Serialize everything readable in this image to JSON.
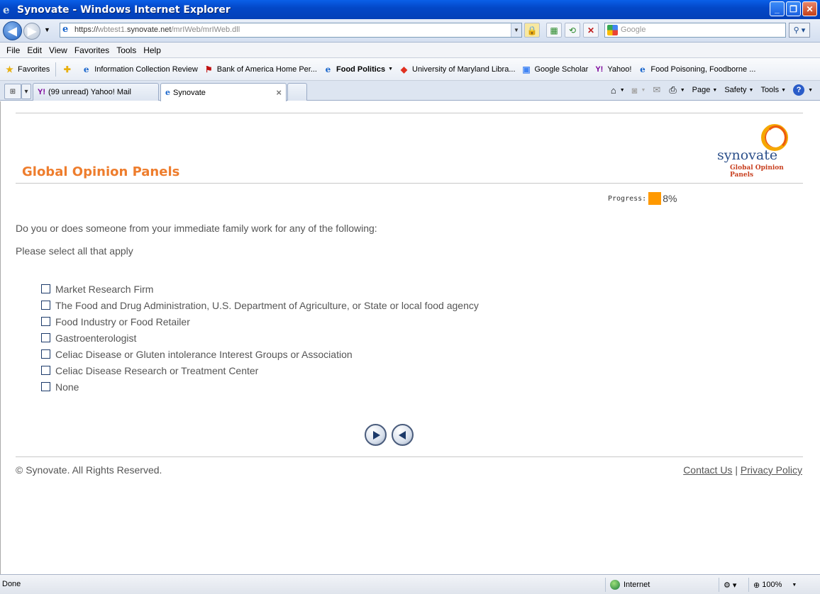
{
  "window": {
    "title": "Synovate - Windows Internet Explorer",
    "minimize": "_",
    "maximize": "❐",
    "close": "✕"
  },
  "address": {
    "prefix": "https://",
    "host_dim": "wbtest1.",
    "host": "synovate.net",
    "path": "/mrIWeb/mrIWeb.dll",
    "search_placeholder": "Google"
  },
  "menu": [
    "File",
    "Edit",
    "View",
    "Favorites",
    "Tools",
    "Help"
  ],
  "favorites": {
    "label": "Favorites",
    "items": [
      {
        "label": "Information Collection Review",
        "icon": "ie-icon"
      },
      {
        "label": "Bank of America  Home  Per...",
        "icon": "boa-icon"
      },
      {
        "label": "Food Politics",
        "icon": "ie-icon",
        "bold": true
      },
      {
        "label": "University of Maryland Libra...",
        "icon": "umd-icon"
      },
      {
        "label": "Google Scholar",
        "icon": "google-scholar-icon"
      },
      {
        "label": "Yahoo!",
        "icon": "yahoo-icon"
      },
      {
        "label": "Food Poisoning, Foodborne ...",
        "icon": "ie-icon"
      }
    ]
  },
  "tabs": [
    {
      "label": "(99 unread) Yahoo! Mail"
    },
    {
      "label": "Synovate"
    }
  ],
  "commands": {
    "page": "Page",
    "safety": "Safety",
    "tools": "Tools"
  },
  "page": {
    "brand": "Global Opinion Panels",
    "logo_name": "synovate",
    "logo_sub": "Global Opinion Panels",
    "progress_label": "Progress:",
    "progress_value": 0.08,
    "progress_text": "8%",
    "question": "Do you or does someone from your immediate family work for any of the following:",
    "instruction": "Please select all that apply",
    "options": [
      "Market Research Firm",
      "The Food and Drug Administration, U.S. Department of Agriculture, or State or local food agency",
      "Food Industry or Food Retailer",
      "Gastroenterologist",
      "Celiac Disease or Gluten intolerance Interest Groups or Association",
      "Celiac Disease Research or Treatment Center",
      "None"
    ],
    "copyright": "© Synovate. All Rights Reserved.",
    "contact": "Contact Us",
    "separator": "|",
    "privacy": "Privacy Policy"
  },
  "status": {
    "text": "Done",
    "zone": "Internet",
    "zoom": "100%"
  },
  "colors": {
    "brand_orange": "#ee7d2d",
    "progress_fill": "#ff9900",
    "titlebar_blue": "#0348c8"
  }
}
